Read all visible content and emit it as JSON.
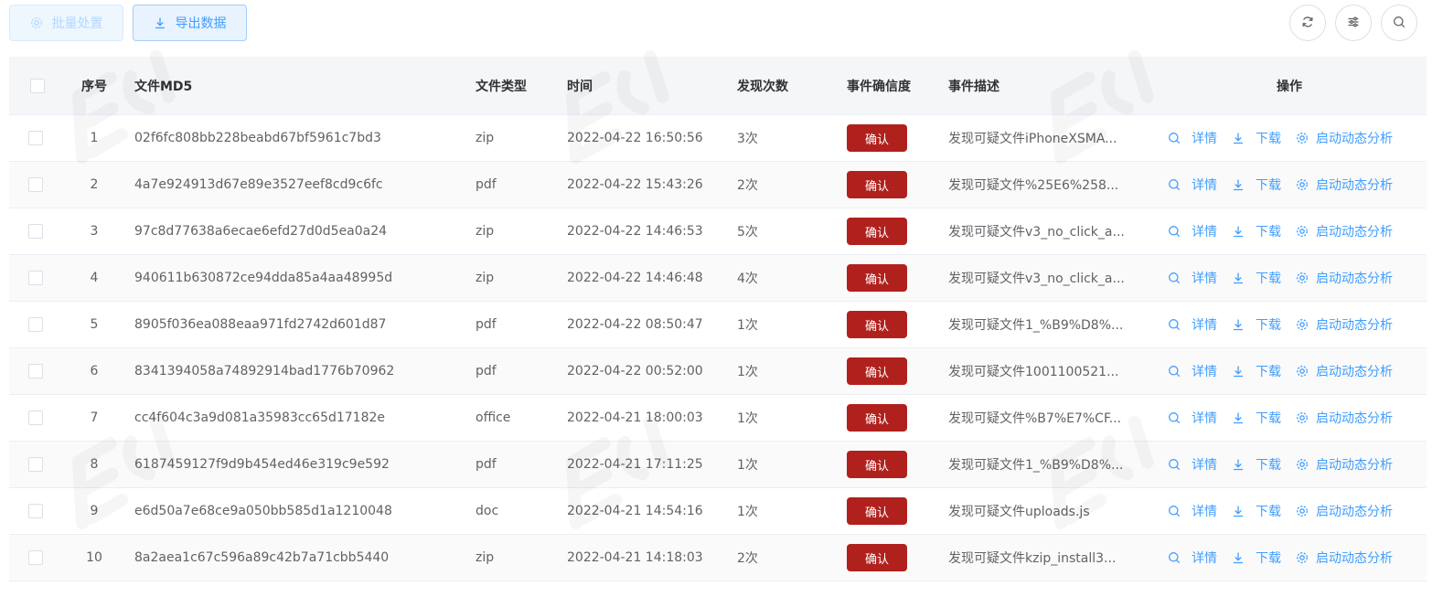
{
  "toolbar": {
    "batch_label": "批量处置",
    "export_label": "导出数据"
  },
  "columns": {
    "index": "序号",
    "md5": "文件MD5",
    "type": "文件类型",
    "time": "时间",
    "count": "发现次数",
    "confidence": "事件确信度",
    "desc": "事件描述",
    "ops": "操作"
  },
  "actions": {
    "detail": "详情",
    "download": "下载",
    "analyze": "启动动态分析"
  },
  "colors": {
    "primary": "#409eff",
    "badge": "#b0211d"
  },
  "rows": [
    {
      "index": "1",
      "md5": "02f6fc808bb228beabd67bf5961c7bd3",
      "type": "zip",
      "time": "2022-04-22 16:50:56",
      "count": "3次",
      "confidence": "确认",
      "desc": "发现可疑文件iPhoneXSMA..."
    },
    {
      "index": "2",
      "md5": "4a7e924913d67e89e3527eef8cd9c6fc",
      "type": "pdf",
      "time": "2022-04-22 15:43:26",
      "count": "2次",
      "confidence": "确认",
      "desc": "发现可疑文件%25E6%258..."
    },
    {
      "index": "3",
      "md5": "97c8d77638a6ecae6efd27d0d5ea0a24",
      "type": "zip",
      "time": "2022-04-22 14:46:53",
      "count": "5次",
      "confidence": "确认",
      "desc": "发现可疑文件v3_no_click_a..."
    },
    {
      "index": "4",
      "md5": "940611b630872ce94dda85a4aa48995d",
      "type": "zip",
      "time": "2022-04-22 14:46:48",
      "count": "4次",
      "confidence": "确认",
      "desc": "发现可疑文件v3_no_click_a..."
    },
    {
      "index": "5",
      "md5": "8905f036ea088eaa971fd2742d601d87",
      "type": "pdf",
      "time": "2022-04-22 08:50:47",
      "count": "1次",
      "confidence": "确认",
      "desc": "发现可疑文件1_%B9%D8%..."
    },
    {
      "index": "6",
      "md5": "8341394058a74892914bad1776b70962",
      "type": "pdf",
      "time": "2022-04-22 00:52:00",
      "count": "1次",
      "confidence": "确认",
      "desc": "发现可疑文件1001100521..."
    },
    {
      "index": "7",
      "md5": "cc4f604c3a9d081a35983cc65d17182e",
      "type": "office",
      "time": "2022-04-21 18:00:03",
      "count": "1次",
      "confidence": "确认",
      "desc": "发现可疑文件%B7%E7%CF..."
    },
    {
      "index": "8",
      "md5": "6187459127f9d9b454ed46e319c9e592",
      "type": "pdf",
      "time": "2022-04-21 17:11:25",
      "count": "1次",
      "confidence": "确认",
      "desc": "发现可疑文件1_%B9%D8%..."
    },
    {
      "index": "9",
      "md5": "e6d50a7e68ce9a050bb585d1a1210048",
      "type": "doc",
      "time": "2022-04-21 14:54:16",
      "count": "1次",
      "confidence": "确认",
      "desc": "发现可疑文件uploads.js"
    },
    {
      "index": "10",
      "md5": "8a2aea1c67c596a89c42b7a71cbb5440",
      "type": "zip",
      "time": "2022-04-21 14:18:03",
      "count": "2次",
      "confidence": "确认",
      "desc": "发现可疑文件kzip_install3..."
    }
  ]
}
